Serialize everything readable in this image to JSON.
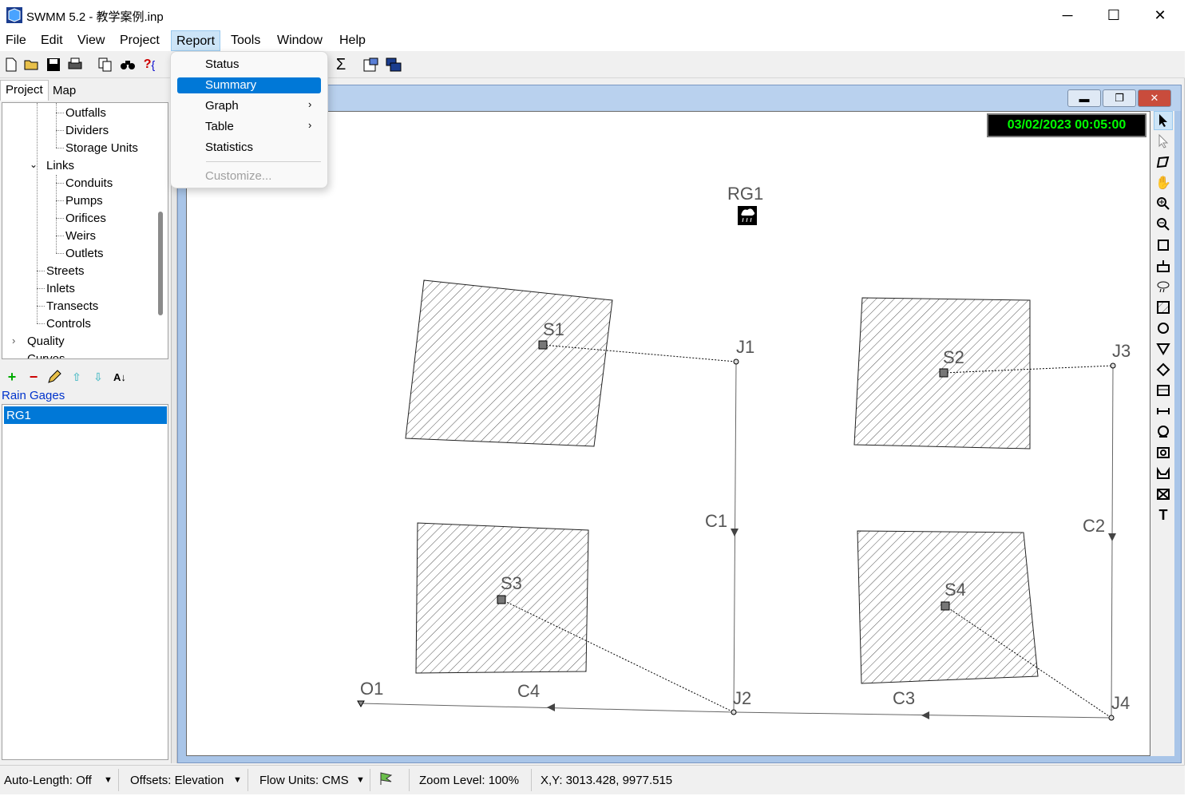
{
  "window": {
    "title": "SWMM 5.2 - 教学案例.inp",
    "minimize": "─",
    "maximize": "☐",
    "close": "✕"
  },
  "menubar": [
    "File",
    "Edit",
    "View",
    "Project",
    "Report",
    "Tools",
    "Window",
    "Help"
  ],
  "left_panel": {
    "tabs": [
      "Project",
      "Map"
    ],
    "tree": {
      "items": [
        "Outfalls",
        "Dividers",
        "Storage Units",
        "Links",
        "Conduits",
        "Pumps",
        "Orifices",
        "Weirs",
        "Outlets",
        "Streets",
        "Inlets",
        "Transects",
        "Controls",
        "Quality",
        "Curves"
      ]
    },
    "category": "Rain Gages",
    "objects": [
      "RG1"
    ]
  },
  "report_menu": {
    "items": [
      "Status",
      "Summary",
      "Graph",
      "Table",
      "Statistics",
      "Customize..."
    ],
    "highlighted": "Summary",
    "submenu_arrow": "›"
  },
  "map": {
    "datetime": "03/02/2023 00:05:00",
    "labels": {
      "rain_gage": "RG1",
      "subcatchments": [
        "S1",
        "S2",
        "S3",
        "S4"
      ],
      "junctions": [
        "J1",
        "J2",
        "J3",
        "J4"
      ],
      "outfall": "O1",
      "conduits": [
        "C1",
        "C2",
        "C3",
        "C4"
      ]
    }
  },
  "statusbar": {
    "auto_length": "Auto-Length: Off",
    "offsets": "Offsets: Elevation",
    "flow_units": "Flow Units: CMS",
    "zoom": "Zoom Level: 100%",
    "xy": "X,Y: 3013.428, 9977.515"
  },
  "colors": {
    "highlight": "#0078d7",
    "date_text": "#00ff00",
    "map_frame": "#a9c5e8"
  }
}
